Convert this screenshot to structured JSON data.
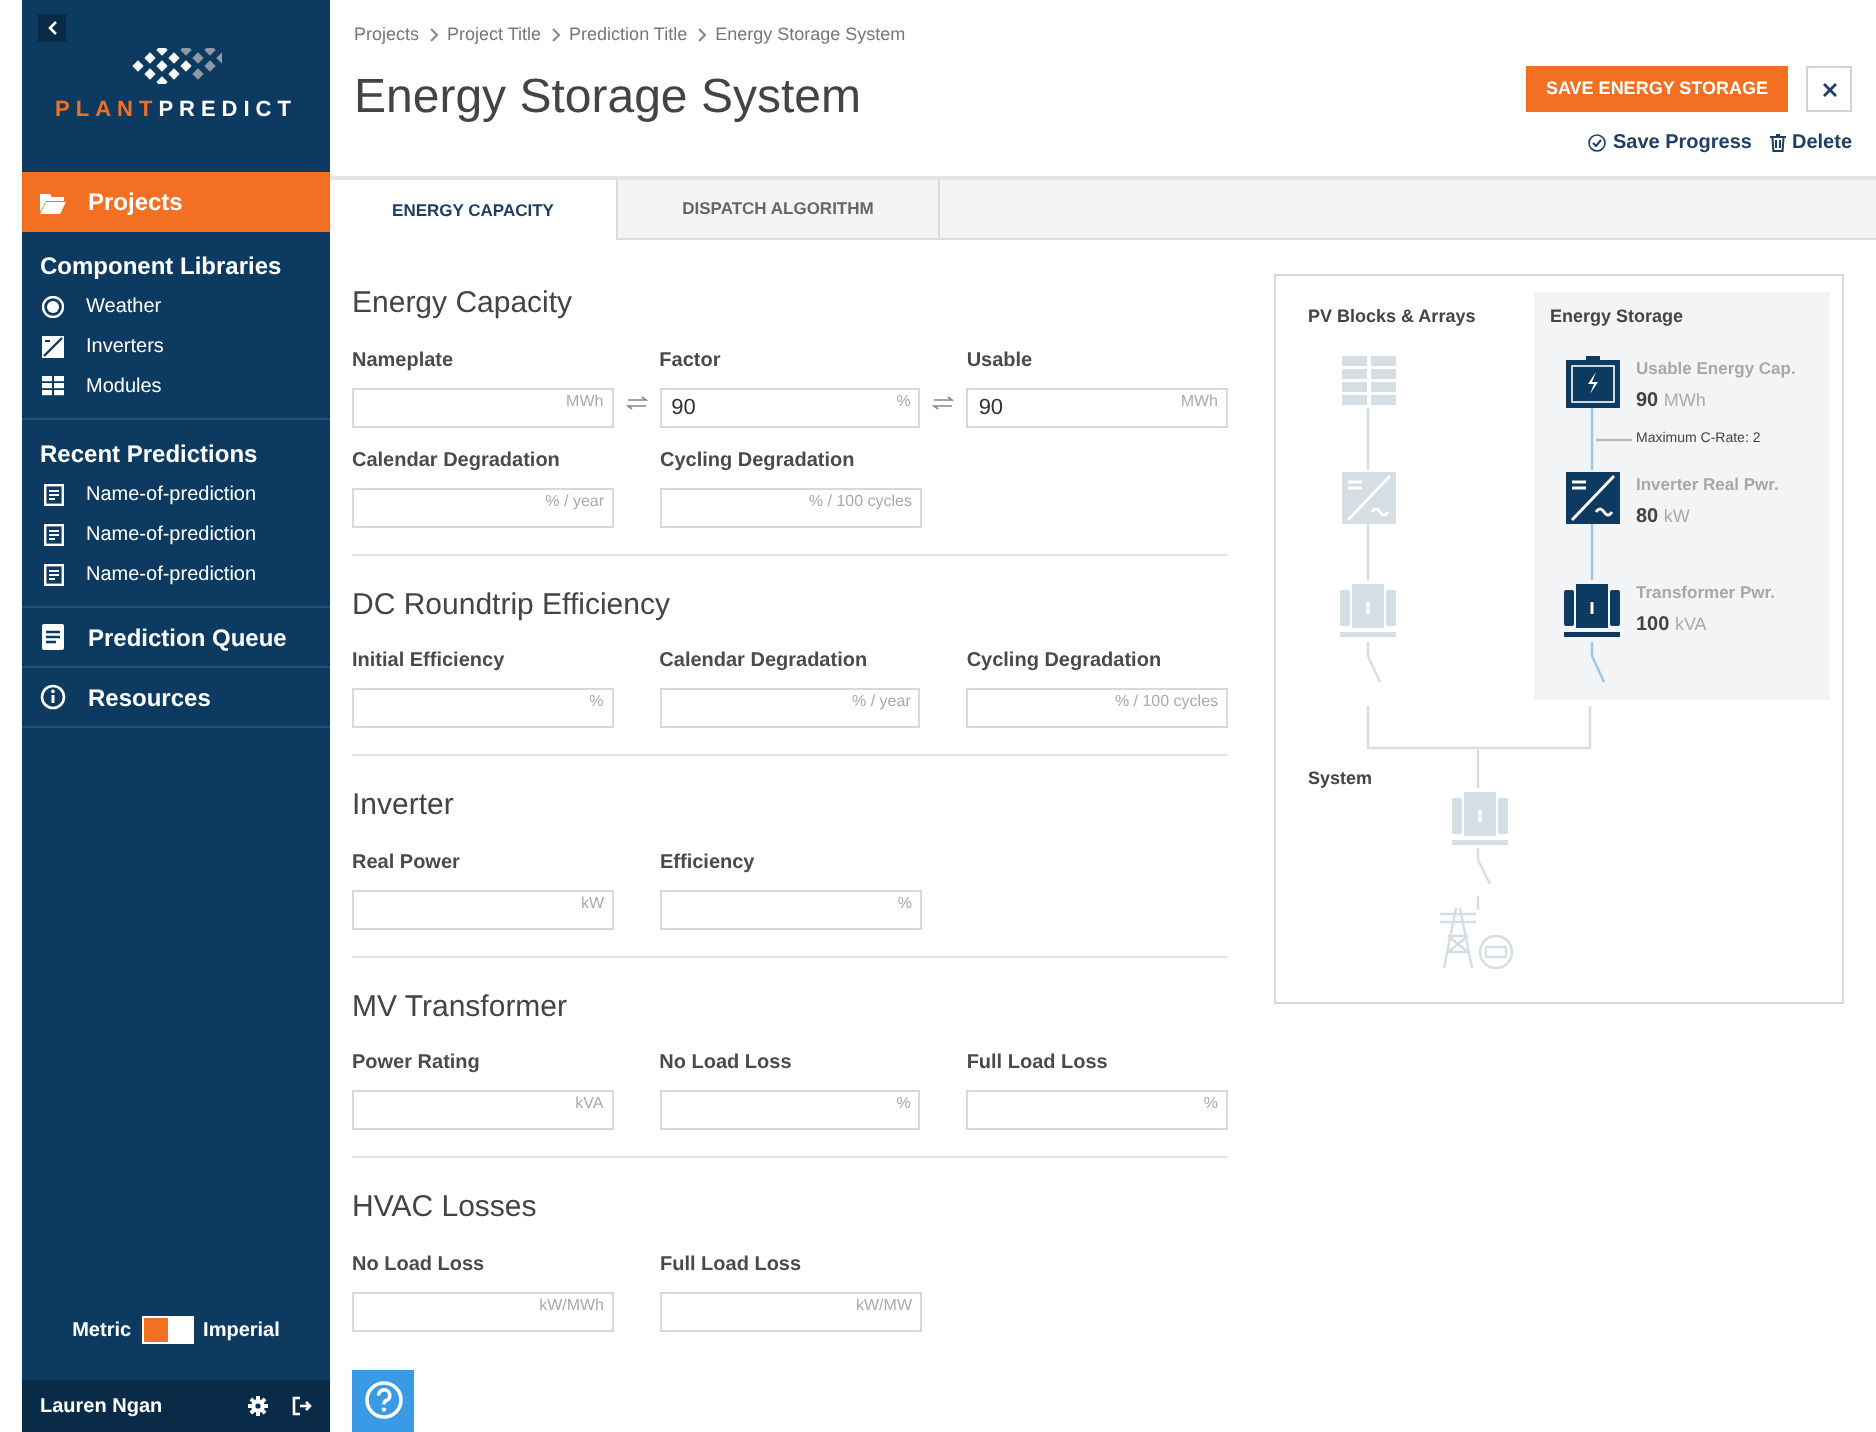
{
  "sidebar": {
    "logo": {
      "first": "PLANT",
      "second": "PREDICT"
    },
    "nav": [
      {
        "label": "Projects",
        "selected": true
      },
      {
        "label": "Component Libraries",
        "children": [
          {
            "label": "Weather"
          },
          {
            "label": "Inverters"
          },
          {
            "label": "Modules"
          }
        ]
      },
      {
        "label": "Recent Predictions",
        "children": [
          {
            "label": "Name-of-prediction"
          },
          {
            "label": "Name-of-prediction"
          },
          {
            "label": "Name-of-prediction"
          }
        ]
      },
      {
        "label": "Prediction Queue",
        "selected": false
      },
      {
        "label": "Resources",
        "selected": false
      }
    ],
    "units": {
      "left": "Metric",
      "right": "Imperial",
      "imperial_selected": false
    },
    "user": "Lauren Ngan"
  },
  "breadcrumb": [
    "Projects",
    "Project Title",
    "Prediction Title",
    "Energy Storage System"
  ],
  "title": "Energy Storage System",
  "save_button": "SAVE ENERGY STORAGE",
  "links": [
    "Save Progress",
    "Delete"
  ],
  "tabs": [
    {
      "label": "ENERGY CAPACITY",
      "selected": true
    },
    {
      "label": "DISPATCH ALGORITHM",
      "selected": false
    }
  ],
  "sections": [
    {
      "title": "Energy Capacity",
      "rows": [
        [
          {
            "label": "Nameplate",
            "unit": "MWh",
            "linked": true
          },
          {
            "label": "Factor",
            "unit": "%",
            "value": "90",
            "linked": true
          },
          {
            "label": "Usable",
            "unit": "MWh",
            "value": "90"
          }
        ],
        [
          {
            "label": "Calendar Degradation",
            "unit": "% / year"
          },
          {
            "label": "Cycling Degradation",
            "unit": "% / 100 cycles"
          }
        ]
      ]
    },
    {
      "title": "DC Roundtrip Efficiency",
      "rows": [
        [
          {
            "label": "Initial Efficiency",
            "unit": "%"
          },
          {
            "label": "Calendar Degradation",
            "unit": "% / year"
          },
          {
            "label": "Cycling Degradation",
            "unit": "% / 100 cycles"
          }
        ]
      ]
    },
    {
      "title": "Inverter",
      "rows": [
        [
          {
            "label": "Real Power",
            "unit": "kW"
          },
          {
            "label": "Efficiency",
            "unit": "%"
          }
        ]
      ]
    },
    {
      "title": "MV Transformer",
      "rows": [
        [
          {
            "label": "Power Rating",
            "unit": "kVA"
          },
          {
            "label": "No Load Loss",
            "unit": "%"
          },
          {
            "label": "Full Load Loss",
            "unit": "%"
          }
        ]
      ]
    },
    {
      "title": "HVAC Losses",
      "rows": [
        [
          {
            "label": "No Load Loss",
            "unit": "kW/MWh"
          },
          {
            "label": "Full Load Loss",
            "unit": "kW/MW"
          }
        ]
      ]
    }
  ],
  "diagram": {
    "pv_title": "PV Blocks & Arrays",
    "storage_title": "Energy Storage",
    "storage_items": [
      {
        "label": "Usable Energy Cap.",
        "value": "90",
        "unit": "MWh"
      },
      {
        "label": "Inverter Real Pwr.",
        "value": "80",
        "unit": "kW"
      },
      {
        "label": "Transformer Pwr.",
        "value": "100",
        "unit": "kVA"
      }
    ],
    "c_rate": "Maximum C-Rate: 2",
    "system_title": "System"
  }
}
